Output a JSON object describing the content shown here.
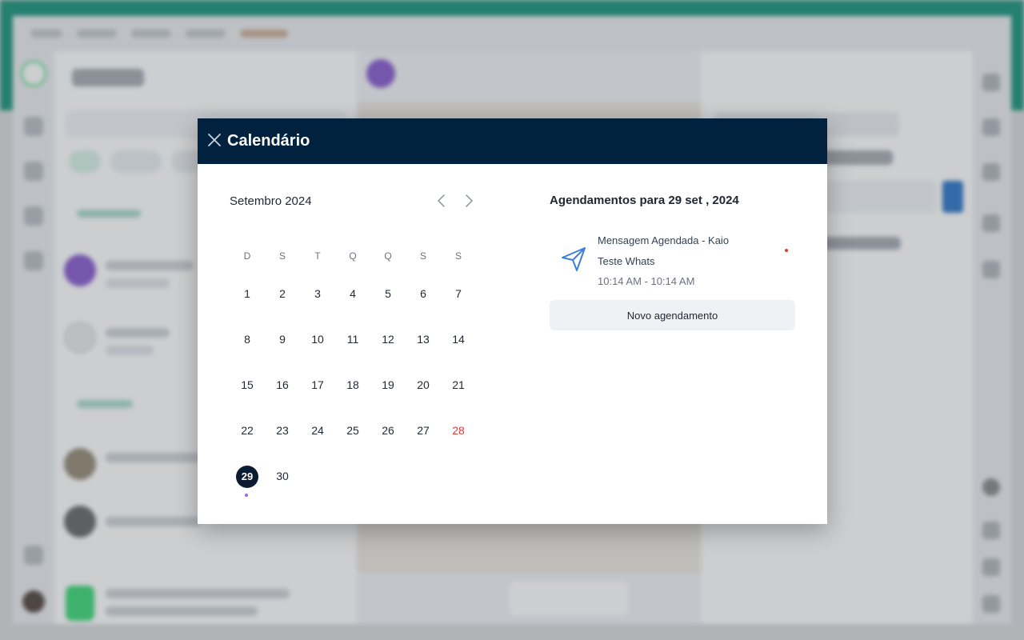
{
  "modal": {
    "title": "Calendário",
    "close_icon": "close-icon"
  },
  "calendar": {
    "month_label": "Setembro 2024",
    "prev_icon": "chevron-left-icon",
    "next_icon": "chevron-right-icon",
    "weekdays": [
      "D",
      "S",
      "T",
      "Q",
      "Q",
      "S",
      "S"
    ],
    "weeks": [
      [
        "1",
        "2",
        "3",
        "4",
        "5",
        "6",
        "7"
      ],
      [
        "8",
        "9",
        "10",
        "11",
        "12",
        "13",
        "14"
      ],
      [
        "15",
        "16",
        "17",
        "18",
        "19",
        "20",
        "21"
      ],
      [
        "22",
        "23",
        "24",
        "25",
        "26",
        "27",
        "28"
      ],
      [
        "29",
        "30"
      ]
    ],
    "selected_day": "29",
    "highlighted_day": "28",
    "day_with_event": "29",
    "colors": {
      "header": "#00223f",
      "selected": "#0b1b30",
      "holiday": "#e53935",
      "event_dot": "#a064e6"
    }
  },
  "agenda": {
    "title": "Agendamentos para 29 set , 2024",
    "events": [
      {
        "title": "Mensagem Agendada - Kaio Teste Whats",
        "time": "10:14 AM - 10:14 AM",
        "icon": "send-icon",
        "status_color": "#e53935"
      }
    ],
    "new_button_label": "Novo agendamento"
  }
}
